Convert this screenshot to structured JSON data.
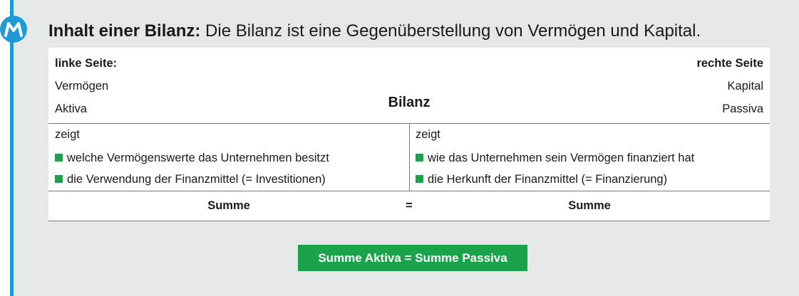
{
  "heading": {
    "bold": "Inhalt einer Bilanz:",
    "text": " Die Bilanz ist eine Gegenüberstellung von Vermögen und Kapital."
  },
  "table": {
    "left_title": "linke Seite:",
    "right_title": "rechte Seite",
    "left_line1": "Vermögen",
    "left_line2": "Aktiva",
    "right_line1": "Kapital",
    "right_line2": "Passiva",
    "center": "Bilanz",
    "left_zeigt": "zeigt",
    "right_zeigt": "zeigt",
    "left_bullets": [
      "welche Vermögenswerte das Unternehmen besitzt",
      "die Verwendung der Finanzmittel (= Investitionen)"
    ],
    "right_bullets": [
      "wie das Unternehmen sein Vermögen finanziert hat",
      "die Herkunft der Finanzmittel (= Finanzierung)"
    ],
    "sum_left": "Summe",
    "equals": "=",
    "sum_right": "Summe"
  },
  "result": "Summe Aktiva = Summe Passiva",
  "colors": {
    "accent_blue": "#1f9ad8",
    "accent_green": "#1aa34a",
    "panel_bg": "#e6e7e7"
  },
  "icons": {
    "badge": "m-logo-icon",
    "bullet": "green-square-bullet-icon"
  }
}
